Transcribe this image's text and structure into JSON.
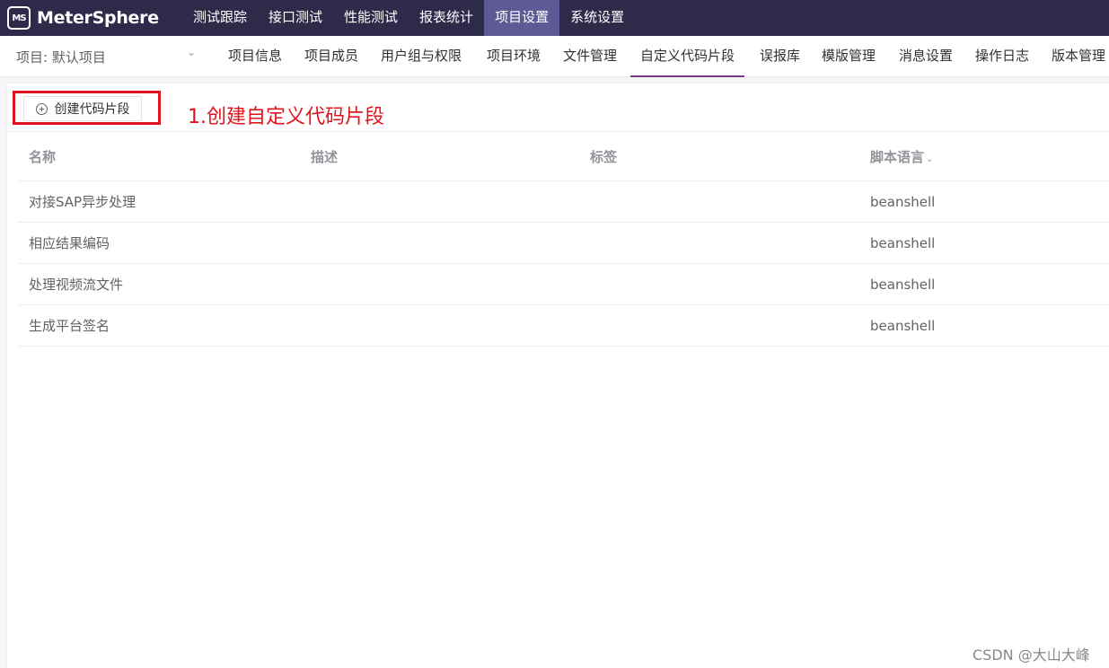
{
  "app": {
    "brand": "MeterSphere",
    "logo_mark": "MS",
    "logo_icon": "cube-logo-icon"
  },
  "top_menu": [
    {
      "label": "测试跟踪",
      "active": false
    },
    {
      "label": "接口测试",
      "active": false
    },
    {
      "label": "性能测试",
      "active": false
    },
    {
      "label": "报表统计",
      "active": false
    },
    {
      "label": "项目设置",
      "active": true
    },
    {
      "label": "系统设置",
      "active": false
    }
  ],
  "sub_nav": {
    "project_label": "项目: 默认项目",
    "project_chevron": "⌄",
    "tabs": [
      {
        "label": "项目信息",
        "active": false
      },
      {
        "label": "项目成员",
        "active": false
      },
      {
        "label": "用户组与权限",
        "active": false
      },
      {
        "label": "项目环境",
        "active": false
      },
      {
        "label": "文件管理",
        "active": false
      },
      {
        "label": "自定义代码片段",
        "active": true
      },
      {
        "label": "误报库",
        "active": false
      },
      {
        "label": "模版管理",
        "active": false
      },
      {
        "label": "消息设置",
        "active": false
      },
      {
        "label": "操作日志",
        "active": false
      },
      {
        "label": "版本管理",
        "active": false
      }
    ]
  },
  "toolbar": {
    "create_label": "创建代码片段",
    "annotation": "1.创建自定义代码片段"
  },
  "table": {
    "columns": [
      "名称",
      "描述",
      "标签",
      "脚本语言"
    ],
    "sort_indicator": "⌄",
    "rows": [
      {
        "name": "对接SAP异步处理",
        "desc": "",
        "tags": "",
        "lang": "beanshell"
      },
      {
        "name": "相应结果编码",
        "desc": "",
        "tags": "",
        "lang": "beanshell"
      },
      {
        "name": "处理视频流文件",
        "desc": "",
        "tags": "",
        "lang": "beanshell"
      },
      {
        "name": "生成平台签名",
        "desc": "",
        "tags": "",
        "lang": "beanshell"
      }
    ]
  },
  "watermark": "CSDN @大山大峰",
  "colors": {
    "topbar": "#2d2a4a",
    "active_menu": "#5e5a96",
    "active_tab_underline": "#783887",
    "annotation_red": "#e0141e"
  }
}
